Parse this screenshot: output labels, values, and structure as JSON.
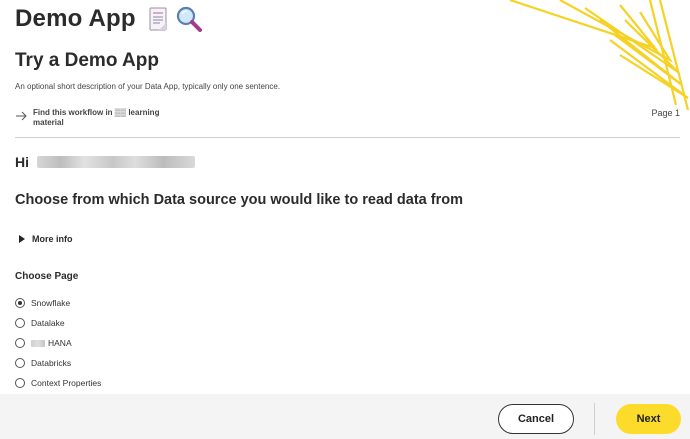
{
  "app": {
    "title": "Demo App",
    "icons": [
      "document-icon",
      "magnifier-icon"
    ]
  },
  "page": {
    "heading": "Try a Demo App",
    "description": "An optional short description of your Data App, typically only one sentence.",
    "learning_link": "Find this workflow in ▒▒ learning material",
    "page_indicator": "Page 1"
  },
  "greeting": {
    "hi": "Hi"
  },
  "section": {
    "heading": "Choose from which Data source you would like to read data from",
    "more_info": "More info"
  },
  "choose_page": {
    "label": "Choose Page",
    "selected": "Snowflake",
    "options": [
      {
        "label": "Snowflake",
        "checked": true
      },
      {
        "label": "Datalake",
        "checked": false
      },
      {
        "label": "HANA",
        "checked": false,
        "prefix_redacted": true
      },
      {
        "label": "Databricks",
        "checked": false
      },
      {
        "label": "Context Properties",
        "checked": false
      }
    ]
  },
  "footer": {
    "cancel_label": "Cancel",
    "next_label": "Next"
  },
  "colors": {
    "accent": "#fddb2a",
    "decoration": "#f5d223",
    "text": "#2b2b2b",
    "footer_bg": "#f4f4f4"
  }
}
